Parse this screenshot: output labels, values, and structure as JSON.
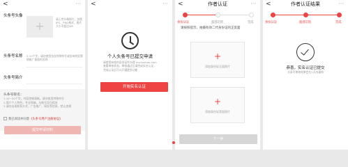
{
  "screen1": {
    "more": "···",
    "avatar_label": "头条号头像",
    "avatar_hint": "请上传头像照片，仅限JPG、PNG格式，图片大小不超过5M",
    "name_label": "头条号名称",
    "name_placeholder": "2-10个字，请勿使用包含特殊符号或含有明显营销推广意图的名称",
    "intro_label": "头条号简介",
    "notice_title": "头条号取名：",
    "notice_lines": [
      "1.10~20个字，内容控制清晰，请勿使用特殊符号",
      "2.简介个人特色，专业领域，与账号定位相关",
      "3.请勿出现联系方式、广告推广、网址等信息，禁止违规"
    ],
    "agree_prefix": "我已阅读并同意",
    "agree_link": "《头条号用户注册协议》",
    "submit_label": "提交申请材料"
  },
  "screen2": {
    "more": "···",
    "heading": "个人头条号已提交申请",
    "desc": "请使用有效的身份证件办理 mp.toutiao.com 查看审核状态，审核通过后请完成实名认证，完成认证后可以开通更多功能",
    "button": "开始实名认证"
  },
  "screen3": {
    "title": "作者认证",
    "more": "···",
    "steps": [
      "身份认证",
      "面部识别",
      "完成"
    ],
    "instruction": "请按照提示，拍摄有效二代身份证的正反面",
    "upload_front": "添加身份证正面照片",
    "upload_back": "添加身份证背面照片",
    "next": "下一步"
  },
  "screen4": {
    "title": "作者认证结果",
    "more": "···",
    "steps": [
      "身份认证",
      "面部识别",
      "完成"
    ],
    "heading": "恭喜，实名认证已提交",
    "sub": "头条号审核结果会在1天内通知"
  },
  "colors": {
    "accent": "#ee4343",
    "disabled": "#efb6b2"
  }
}
